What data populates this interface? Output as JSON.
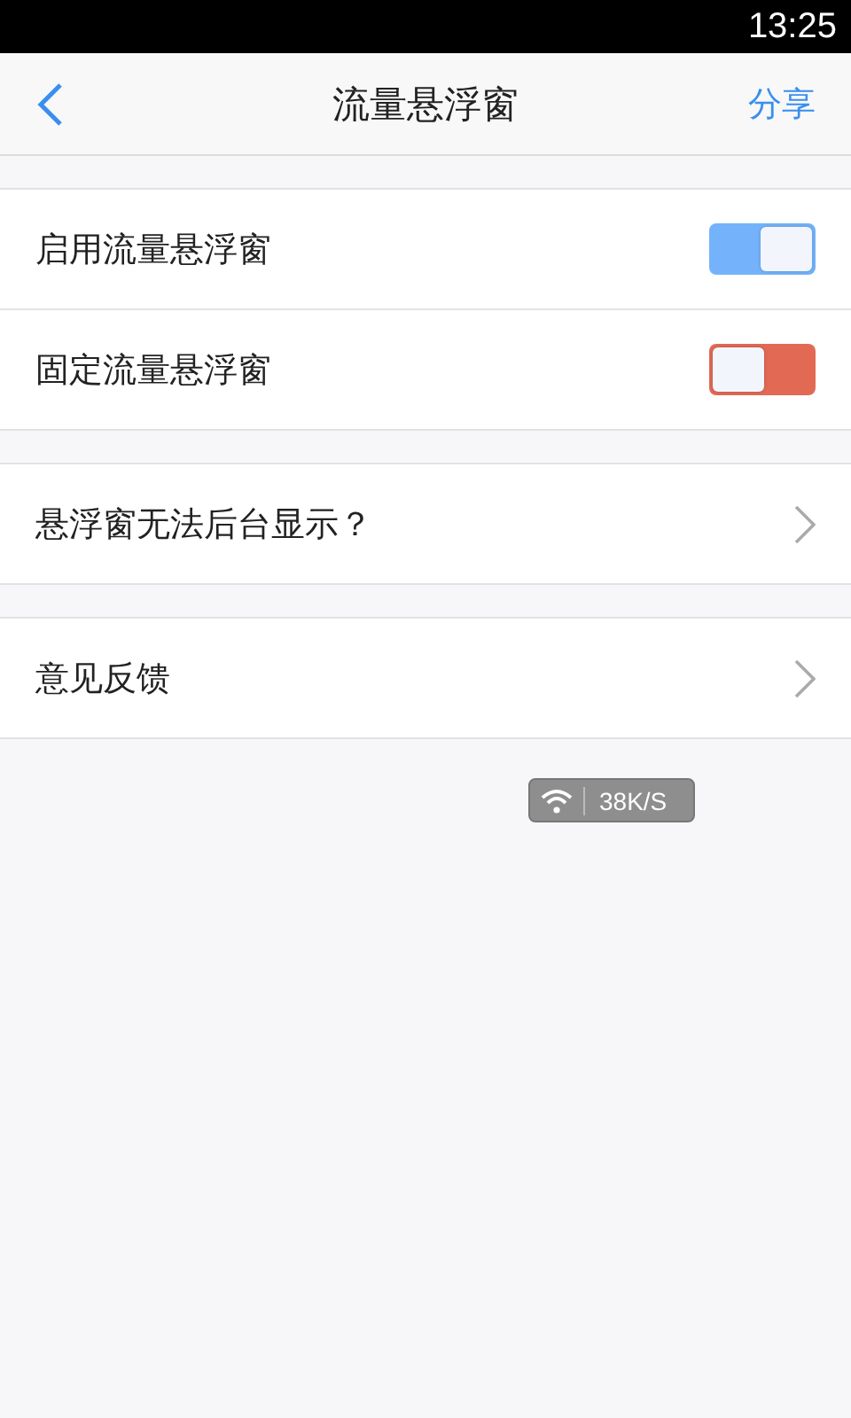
{
  "status_bar": {
    "time": "13:25"
  },
  "nav": {
    "title": "流量悬浮窗",
    "action": "分享"
  },
  "groups": [
    {
      "items": [
        {
          "kind": "toggle",
          "label": "启用流量悬浮窗",
          "on": true,
          "color": "#74b3fb"
        },
        {
          "kind": "toggle",
          "label": "固定流量悬浮窗",
          "on": false,
          "color": "#e26a55"
        }
      ]
    },
    {
      "items": [
        {
          "kind": "link",
          "label": "悬浮窗无法后台显示？"
        }
      ]
    },
    {
      "items": [
        {
          "kind": "link",
          "label": "意见反馈"
        }
      ]
    }
  ],
  "floating_widget": {
    "speed": "38K/S"
  }
}
